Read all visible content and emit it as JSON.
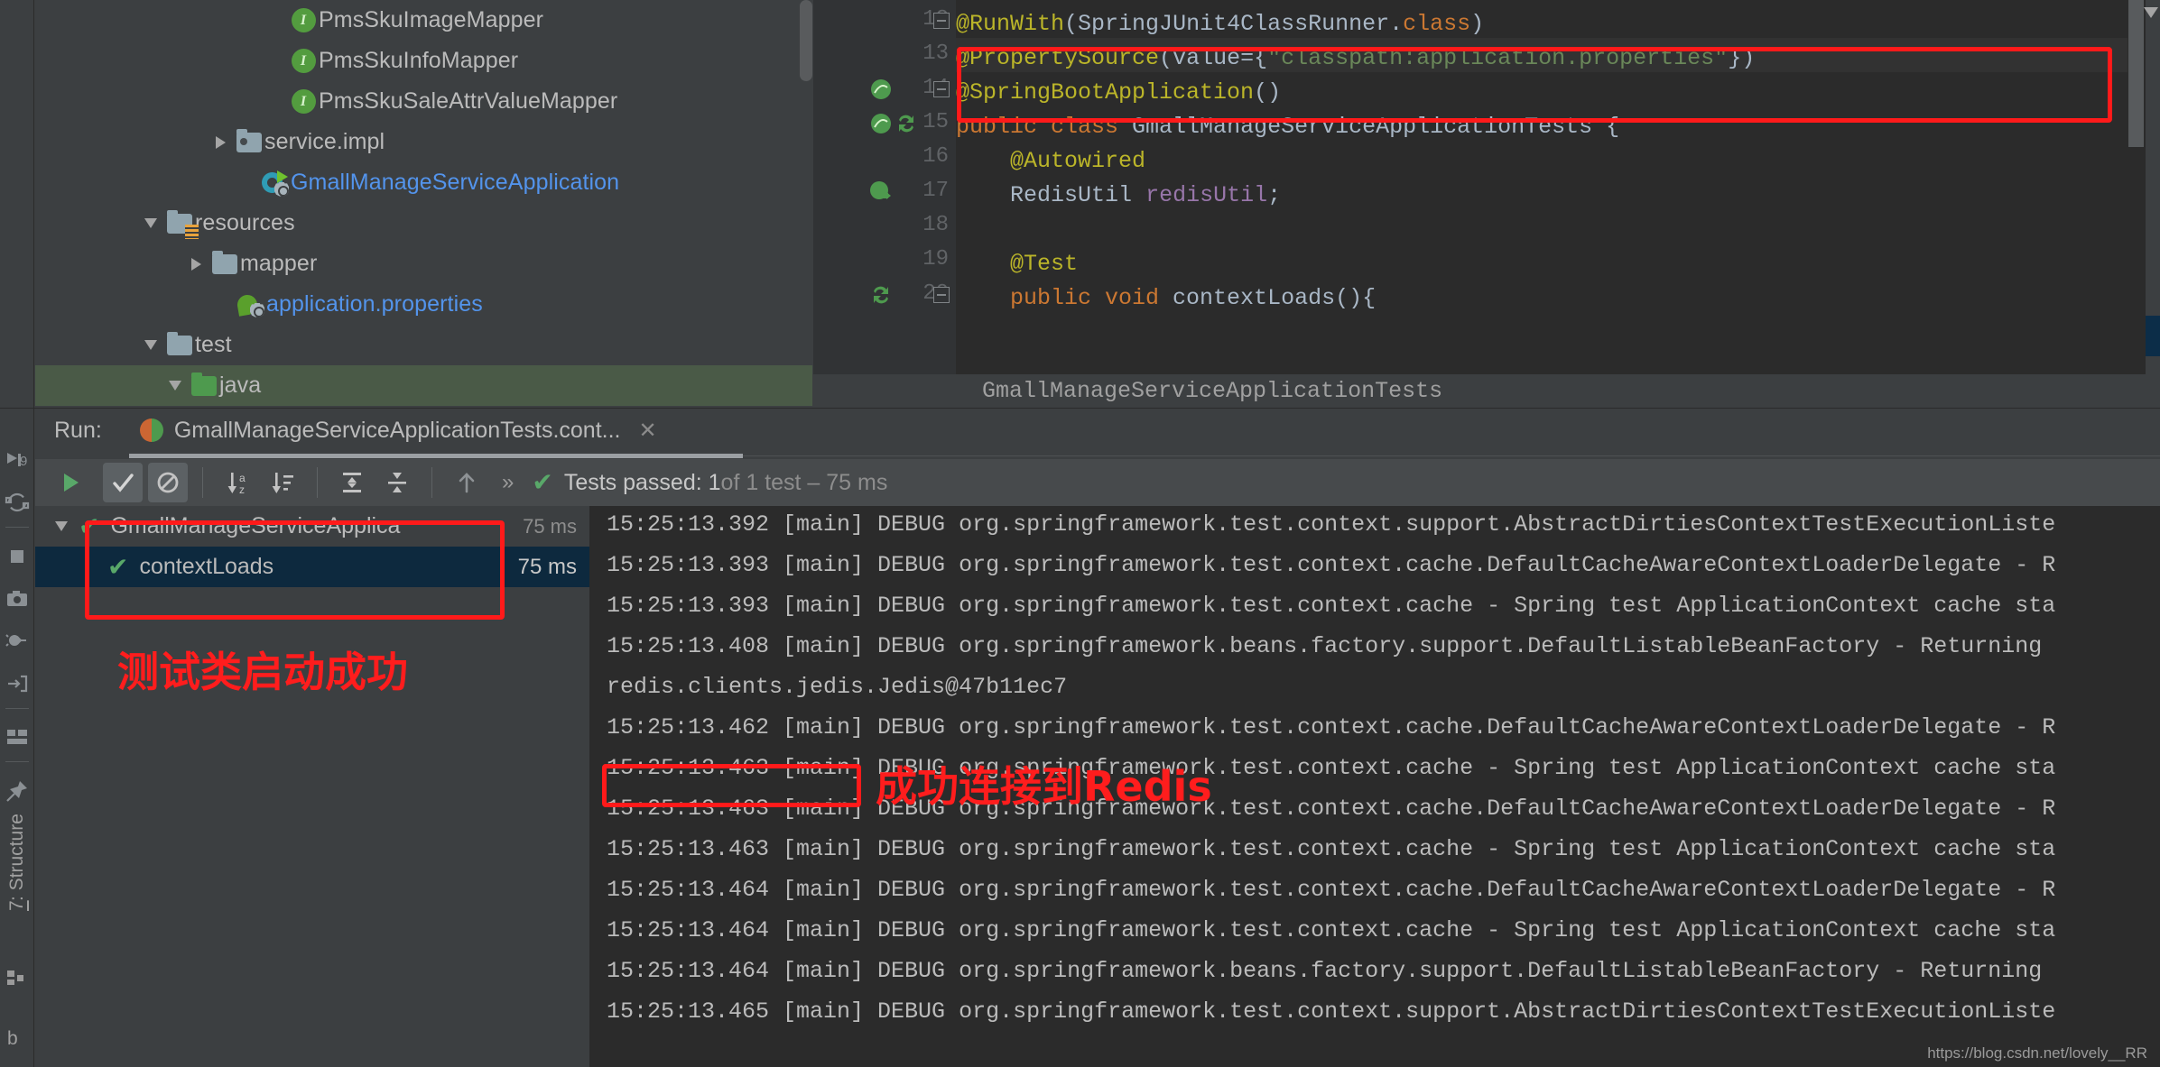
{
  "project_tree": {
    "items": [
      {
        "label": "PmsSkuImageMapper",
        "icon": "interface-icon",
        "indent": 250,
        "twisty": "none",
        "color": "grey"
      },
      {
        "label": "PmsSkuInfoMapper",
        "icon": "interface-icon",
        "indent": 250,
        "twisty": "none",
        "color": "grey"
      },
      {
        "label": "PmsSkuSaleAttrValueMapper",
        "icon": "interface-icon",
        "indent": 250,
        "twisty": "none",
        "color": "grey"
      },
      {
        "label": "service.impl",
        "icon": "package-folder-icon",
        "indent": 190,
        "twisty": "collapsed",
        "color": "grey"
      },
      {
        "label": "GmallManageServiceApplication",
        "icon": "spring-boot-run-icon",
        "indent": 219,
        "twisty": "none",
        "color": "blue"
      },
      {
        "label": "resources",
        "icon": "resources-folder-icon",
        "indent": 113,
        "twisty": "expanded",
        "color": "grey"
      },
      {
        "label": "mapper",
        "icon": "folder-icon",
        "indent": 163,
        "twisty": "collapsed",
        "color": "grey"
      },
      {
        "label": "application.properties",
        "icon": "spring-properties-icon",
        "indent": 192,
        "twisty": "none",
        "color": "blue"
      },
      {
        "label": "test",
        "icon": "folder-icon",
        "indent": 113,
        "twisty": "expanded",
        "color": "grey"
      },
      {
        "label": "java",
        "icon": "source-folder-icon",
        "indent": 140,
        "twisty": "expanded",
        "color": "grey",
        "selected": true
      }
    ]
  },
  "editor": {
    "lines": [
      {
        "num": "12",
        "segments": [
          {
            "t": "@RunWith",
            "c": "ann"
          },
          {
            "t": "(",
            "c": "plain"
          },
          {
            "t": "SpringJUnit4ClassRunner",
            "c": "cls"
          },
          {
            "t": ".",
            "c": "plain"
          },
          {
            "t": "class",
            "c": "kw"
          },
          {
            "t": ")",
            "c": "plain"
          }
        ]
      },
      {
        "num": "13",
        "segments": [
          {
            "t": "@PropertySource",
            "c": "ann"
          },
          {
            "t": "(",
            "c": "plain"
          },
          {
            "t": "value=",
            "c": "plain"
          },
          {
            "t": "{",
            "c": "plain"
          },
          {
            "t": "\"classpath:application.properties\"",
            "c": "str"
          },
          {
            "t": "})",
            "c": "plain"
          }
        ]
      },
      {
        "num": "14",
        "segments": [
          {
            "t": "@SpringBootApplication",
            "c": "ann"
          },
          {
            "t": "()",
            "c": "plain"
          }
        ]
      },
      {
        "num": "15",
        "segments": [
          {
            "t": "public class ",
            "c": "kw"
          },
          {
            "t": "GmallManageServiceApplicationTests",
            "c": "cls"
          },
          {
            "t": " {",
            "c": "plain"
          }
        ]
      },
      {
        "num": "16",
        "segments": [
          {
            "t": "    @Autowired",
            "c": "ann"
          }
        ]
      },
      {
        "num": "17",
        "segments": [
          {
            "t": "    ",
            "c": "plain"
          },
          {
            "t": "RedisUtil",
            "c": "cls"
          },
          {
            "t": " ",
            "c": "plain"
          },
          {
            "t": "redisUtil",
            "c": "fld"
          },
          {
            "t": ";",
            "c": "plain"
          }
        ]
      },
      {
        "num": "18",
        "segments": []
      },
      {
        "num": "19",
        "segments": [
          {
            "t": "    @Test",
            "c": "ann"
          }
        ]
      },
      {
        "num": "20",
        "segments": [
          {
            "t": "    public void ",
            "c": "kw"
          },
          {
            "t": "contextLoads",
            "c": "cls"
          },
          {
            "t": "(){",
            "c": "plain"
          }
        ]
      }
    ],
    "breadcrumb": "GmallManageServiceApplicationTests"
  },
  "run_panel": {
    "run_label": "Run:",
    "tab_title": "GmallManageServiceApplicationTests.cont...",
    "tab_close": "✕",
    "toolbar": {
      "buttons": [
        {
          "name": "rerun-button",
          "icon": "play-icon"
        },
        {
          "name": "show-passed-button",
          "icon": "checkmark-icon",
          "active": true
        },
        {
          "name": "show-ignored-button",
          "icon": "no-entry-icon",
          "active": true
        },
        {
          "name": "sort-alphabetically-button",
          "icon": "sort-alpha-icon"
        },
        {
          "name": "sort-by-duration-button",
          "icon": "sort-duration-icon"
        },
        {
          "name": "expand-all-button",
          "icon": "expand-all-icon"
        },
        {
          "name": "collapse-all-button",
          "icon": "collapse-all-icon"
        },
        {
          "name": "previous-occurrence-button",
          "icon": "arrow-up-icon"
        }
      ],
      "overflow": "»",
      "status_main": "Tests passed: 1",
      "status_dim": " of 1 test – 75 ms"
    },
    "results": [
      {
        "name": "GmallManageServiceApplica",
        "time": "75 ms",
        "twisty": "expanded",
        "selected": false
      },
      {
        "name": "contextLoads",
        "time": "75 ms",
        "twisty": "none",
        "selected": true
      }
    ],
    "annotation_tests": "测试类启动成功",
    "annotation_redis": "成功连接到Redis",
    "console_lines": [
      "15:25:13.392 [main] DEBUG org.springframework.test.context.support.AbstractDirtiesContextTestExecutionListe",
      "15:25:13.393 [main] DEBUG org.springframework.test.context.cache.DefaultCacheAwareContextLoaderDelegate - R",
      "15:25:13.393 [main] DEBUG org.springframework.test.context.cache - Spring test ApplicationContext cache sta",
      "15:25:13.408 [main] DEBUG org.springframework.beans.factory.support.DefaultListableBeanFactory - Returning ",
      "redis.clients.jedis.Jedis@47b11ec7",
      "15:25:13.462 [main] DEBUG org.springframework.test.context.cache.DefaultCacheAwareContextLoaderDelegate - R",
      "15:25:13.463 [main] DEBUG org.springframework.test.context.cache - Spring test ApplicationContext cache sta",
      "15:25:13.463 [main] DEBUG org.springframework.test.context.cache.DefaultCacheAwareContextLoaderDelegate - R",
      "15:25:13.463 [main] DEBUG org.springframework.test.context.cache - Spring test ApplicationContext cache sta",
      "15:25:13.464 [main] DEBUG org.springframework.test.context.cache.DefaultCacheAwareContextLoaderDelegate - R",
      "15:25:13.464 [main] DEBUG org.springframework.test.context.cache - Spring test ApplicationContext cache sta",
      "15:25:13.464 [main] DEBUG org.springframework.beans.factory.support.DefaultListableBeanFactory - Returning ",
      "15:25:13.465 [main] DEBUG org.springframework.test.context.support.AbstractDirtiesContextTestExecutionListe"
    ],
    "watermark": "https://blog.csdn.net/lovely__RR"
  },
  "sidebar": {
    "structure_label_prefix": "7",
    "structure_label": ": Structure",
    "bottom_letter": "b",
    "icons": [
      {
        "name": "rerun-failed-icon"
      },
      {
        "name": "rerun-auto-icon"
      },
      {
        "name": "stop-icon"
      },
      {
        "name": "export-snapshot-icon"
      },
      {
        "name": "mute-breakpoints-icon"
      },
      {
        "name": "import-results-icon"
      },
      {
        "name": "layout-icon"
      },
      {
        "name": "pin-tab-icon"
      }
    ]
  },
  "colors": {
    "accent_red": "#ff1d1d",
    "pass_green": "#59a869",
    "selection_blue": "#0d293e",
    "editor_bg": "#2b2b2b",
    "panel_bg": "#3c3f41"
  }
}
